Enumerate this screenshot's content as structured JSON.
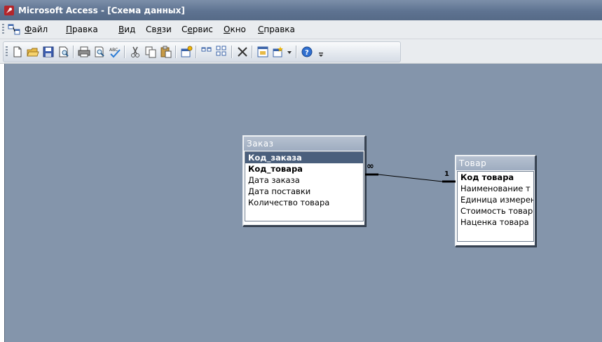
{
  "window": {
    "title": "Microsoft Access - [Схема данных]",
    "app_icon": "access-key-icon"
  },
  "menu": {
    "items": [
      {
        "underline": "Ф",
        "rest": "айл"
      },
      {
        "underline": "П",
        "rest": "равка"
      },
      {
        "underline": "В",
        "rest": "ид"
      },
      {
        "pre": "Св",
        "underline": "я",
        "rest": "зи"
      },
      {
        "pre": "С",
        "underline": "е",
        "rest": "рвис"
      },
      {
        "underline": "О",
        "rest": "кно"
      },
      {
        "underline": "С",
        "rest": "правка"
      }
    ]
  },
  "toolbar": {
    "buttons": [
      "new-icon",
      "open-icon",
      "save-icon",
      "file-search-icon",
      "print-icon",
      "print-preview-icon",
      "spelling-icon",
      "cut-icon",
      "copy-icon",
      "paste-icon",
      "show-table-icon",
      "show-direct-relationships-icon",
      "show-all-relationships-icon",
      "delete-icon",
      "database-window-icon",
      "new-object-icon",
      "help-icon"
    ]
  },
  "diagram": {
    "tables": [
      {
        "name": "Заказ",
        "fields": [
          {
            "label": "Код_заказа",
            "state": "selected"
          },
          {
            "label": "Код_товара",
            "state": "key"
          },
          {
            "label": "Дата заказа",
            "state": "normal"
          },
          {
            "label": "Дата поставки",
            "state": "normal"
          },
          {
            "label": "Количество товара",
            "state": "normal"
          }
        ]
      },
      {
        "name": "Товар",
        "fields": [
          {
            "label": "Код товара",
            "state": "key"
          },
          {
            "label": "Наименование т",
            "state": "normal"
          },
          {
            "label": "Единица измерен",
            "state": "normal"
          },
          {
            "label": "Стоимость товар",
            "state": "normal"
          },
          {
            "label": "Наценка товара",
            "state": "normal"
          }
        ]
      }
    ],
    "relationship": {
      "many_label": "∞",
      "one_label": "1"
    }
  }
}
